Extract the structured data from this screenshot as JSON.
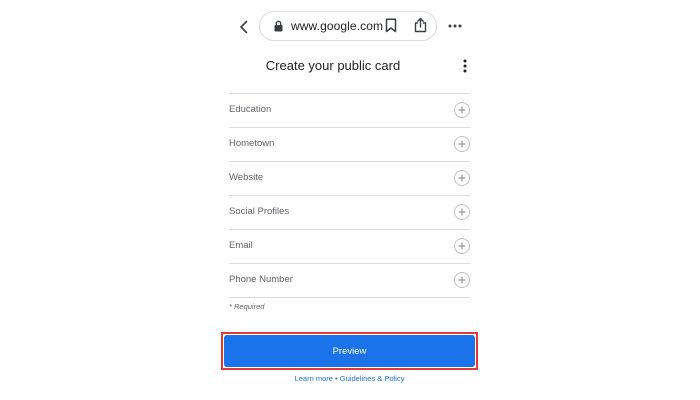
{
  "browser": {
    "url": "www.google.com",
    "icons": [
      "chevron-left-icon",
      "lock-icon",
      "bookmark-icon",
      "share-icon",
      "more-horizontal-icon"
    ]
  },
  "header": {
    "title": "Create your public card",
    "menu_icon": "more-vertical-icon"
  },
  "fields": [
    {
      "label": "Education"
    },
    {
      "label": "Hometown"
    },
    {
      "label": "Website"
    },
    {
      "label": "Social Profiles"
    },
    {
      "label": "Email"
    },
    {
      "label": "Phone Number"
    }
  ],
  "required_note": "* Required",
  "preview_button": {
    "label": "Preview",
    "color": "#1a73e8",
    "highlight_color": "#e53935"
  },
  "footer": {
    "learn_more": "Learn more",
    "separator": "•",
    "guidelines": "Guidelines & Policy"
  }
}
